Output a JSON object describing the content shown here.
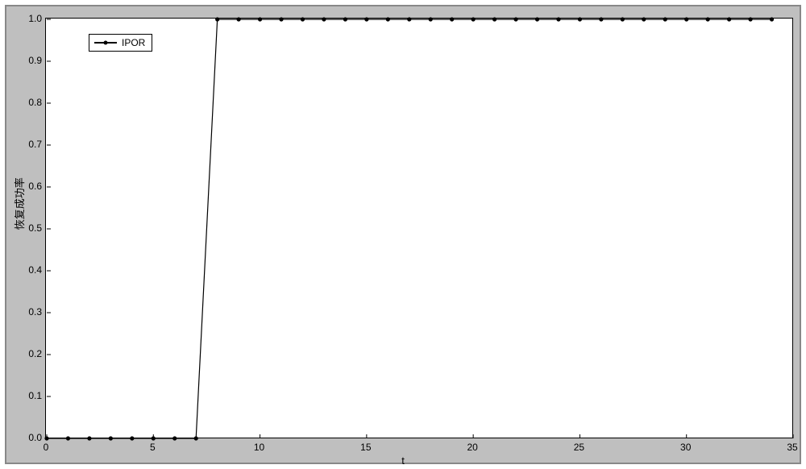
{
  "chart_data": {
    "type": "line",
    "title": "",
    "xlabel": "t",
    "ylabel": "恢复成功率",
    "xlim": [
      0,
      35
    ],
    "ylim": [
      0,
      1.0
    ],
    "x_ticks": [
      0,
      5,
      10,
      15,
      20,
      25,
      30,
      35
    ],
    "y_ticks": [
      0.0,
      0.1,
      0.2,
      0.3,
      0.4,
      0.5,
      0.6,
      0.7,
      0.8,
      0.9,
      1.0
    ],
    "legend_position": "upper-left",
    "series": [
      {
        "name": "IPOR",
        "marker": "circle",
        "color": "#000000",
        "x": [
          0,
          1,
          2,
          3,
          4,
          5,
          6,
          7,
          8,
          9,
          10,
          11,
          12,
          13,
          14,
          15,
          16,
          17,
          18,
          19,
          20,
          21,
          22,
          23,
          24,
          25,
          26,
          27,
          28,
          29,
          30,
          31,
          32,
          33,
          34
        ],
        "values": [
          0,
          0,
          0,
          0,
          0,
          0,
          0,
          0,
          1,
          1,
          1,
          1,
          1,
          1,
          1,
          1,
          1,
          1,
          1,
          1,
          1,
          1,
          1,
          1,
          1,
          1,
          1,
          1,
          1,
          1,
          1,
          1,
          1,
          1,
          1
        ]
      }
    ]
  }
}
